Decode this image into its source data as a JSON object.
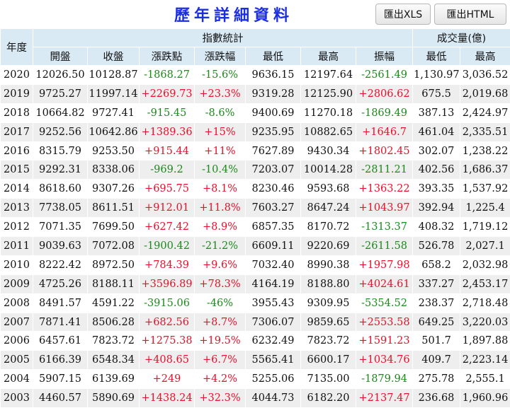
{
  "title": "歷年詳細資料",
  "buttons": {
    "xls": "匯出XLS",
    "html": "匯出HTML"
  },
  "headers": {
    "year": "年度",
    "index_group": "指數統計",
    "volume_group": "成交量(億)",
    "open": "開盤",
    "close": "收盤",
    "change_pts": "漲跌點",
    "change_pct": "漲跌幅",
    "low": "最低",
    "high": "最高",
    "amplitude": "振幅",
    "vol_low": "最低",
    "vol_high": "最高"
  },
  "rows": [
    [
      "2020",
      "12026.50",
      "10128.87",
      "-1868.27",
      "-15.6%",
      "9636.15",
      "12197.64",
      "-2561.49",
      "1,130.97",
      "3,036.52"
    ],
    [
      "2019",
      "9725.27",
      "11997.14",
      "+2269.73",
      "+23.3%",
      "9319.28",
      "12125.90",
      "+2806.62",
      "675.5",
      "2,019.68"
    ],
    [
      "2018",
      "10664.82",
      "9727.41",
      "-915.45",
      "-8.6%",
      "9400.69",
      "11270.18",
      "-1869.49",
      "387.13",
      "2,424.97"
    ],
    [
      "2017",
      "9252.56",
      "10642.86",
      "+1389.36",
      "+15%",
      "9235.95",
      "10882.65",
      "+1646.7",
      "461.04",
      "2,335.51"
    ],
    [
      "2016",
      "8315.79",
      "9253.50",
      "+915.44",
      "+11%",
      "7627.89",
      "9430.34",
      "+1802.45",
      "302.07",
      "1,238.22"
    ],
    [
      "2015",
      "9292.31",
      "8338.06",
      "-969.2",
      "-10.4%",
      "7203.07",
      "10014.28",
      "-2811.21",
      "402.56",
      "1,686.37"
    ],
    [
      "2014",
      "8618.60",
      "9307.26",
      "+695.75",
      "+8.1%",
      "8230.46",
      "9593.68",
      "+1363.22",
      "393.35",
      "1,537.92"
    ],
    [
      "2013",
      "7738.05",
      "8611.51",
      "+912.01",
      "+11.8%",
      "7603.27",
      "8647.24",
      "+1043.97",
      "392.94",
      "1,225.4"
    ],
    [
      "2012",
      "7071.35",
      "7699.50",
      "+627.42",
      "+8.9%",
      "6857.35",
      "8170.72",
      "-1313.37",
      "408.32",
      "1,719.12"
    ],
    [
      "2011",
      "9039.63",
      "7072.08",
      "-1900.42",
      "-21.2%",
      "6609.11",
      "9220.69",
      "-2611.58",
      "526.78",
      "2,027.1"
    ],
    [
      "2010",
      "8222.42",
      "8972.50",
      "+784.39",
      "+9.6%",
      "7032.40",
      "8990.38",
      "+1957.98",
      "658.2",
      "2,032.98"
    ],
    [
      "2009",
      "4725.26",
      "8188.11",
      "+3596.89",
      "+78.3%",
      "4164.19",
      "8188.80",
      "+4024.61",
      "337.27",
      "2,453.17"
    ],
    [
      "2008",
      "8491.57",
      "4591.22",
      "-3915.06",
      "-46%",
      "3955.43",
      "9309.95",
      "-5354.52",
      "238.37",
      "2,718.48"
    ],
    [
      "2007",
      "7871.41",
      "8506.28",
      "+682.56",
      "+8.7%",
      "7306.07",
      "9859.65",
      "+2553.58",
      "649.25",
      "3,220.03"
    ],
    [
      "2006",
      "6457.61",
      "7823.72",
      "+1275.38",
      "+19.5%",
      "6232.49",
      "7823.72",
      "+1591.23",
      "501.7",
      "1,897.88"
    ],
    [
      "2005",
      "6166.39",
      "6548.34",
      "+408.65",
      "+6.7%",
      "5565.41",
      "6600.17",
      "+1034.76",
      "409.7",
      "2,223.14"
    ],
    [
      "2004",
      "5907.15",
      "6139.69",
      "+249",
      "+4.2%",
      "5255.06",
      "7135.00",
      "-1879.94",
      "275.78",
      "2,555.1"
    ],
    [
      "2003",
      "4460.57",
      "5890.69",
      "+1438.24",
      "+32.3%",
      "4044.73",
      "6182.20",
      "+2137.47",
      "236.68",
      "1,960.96"
    ]
  ],
  "colors": {
    "up": "#e8102a",
    "down": "#1a8a1a",
    "header_bg": "#d9eaf5",
    "title": "#1b2fe0"
  }
}
